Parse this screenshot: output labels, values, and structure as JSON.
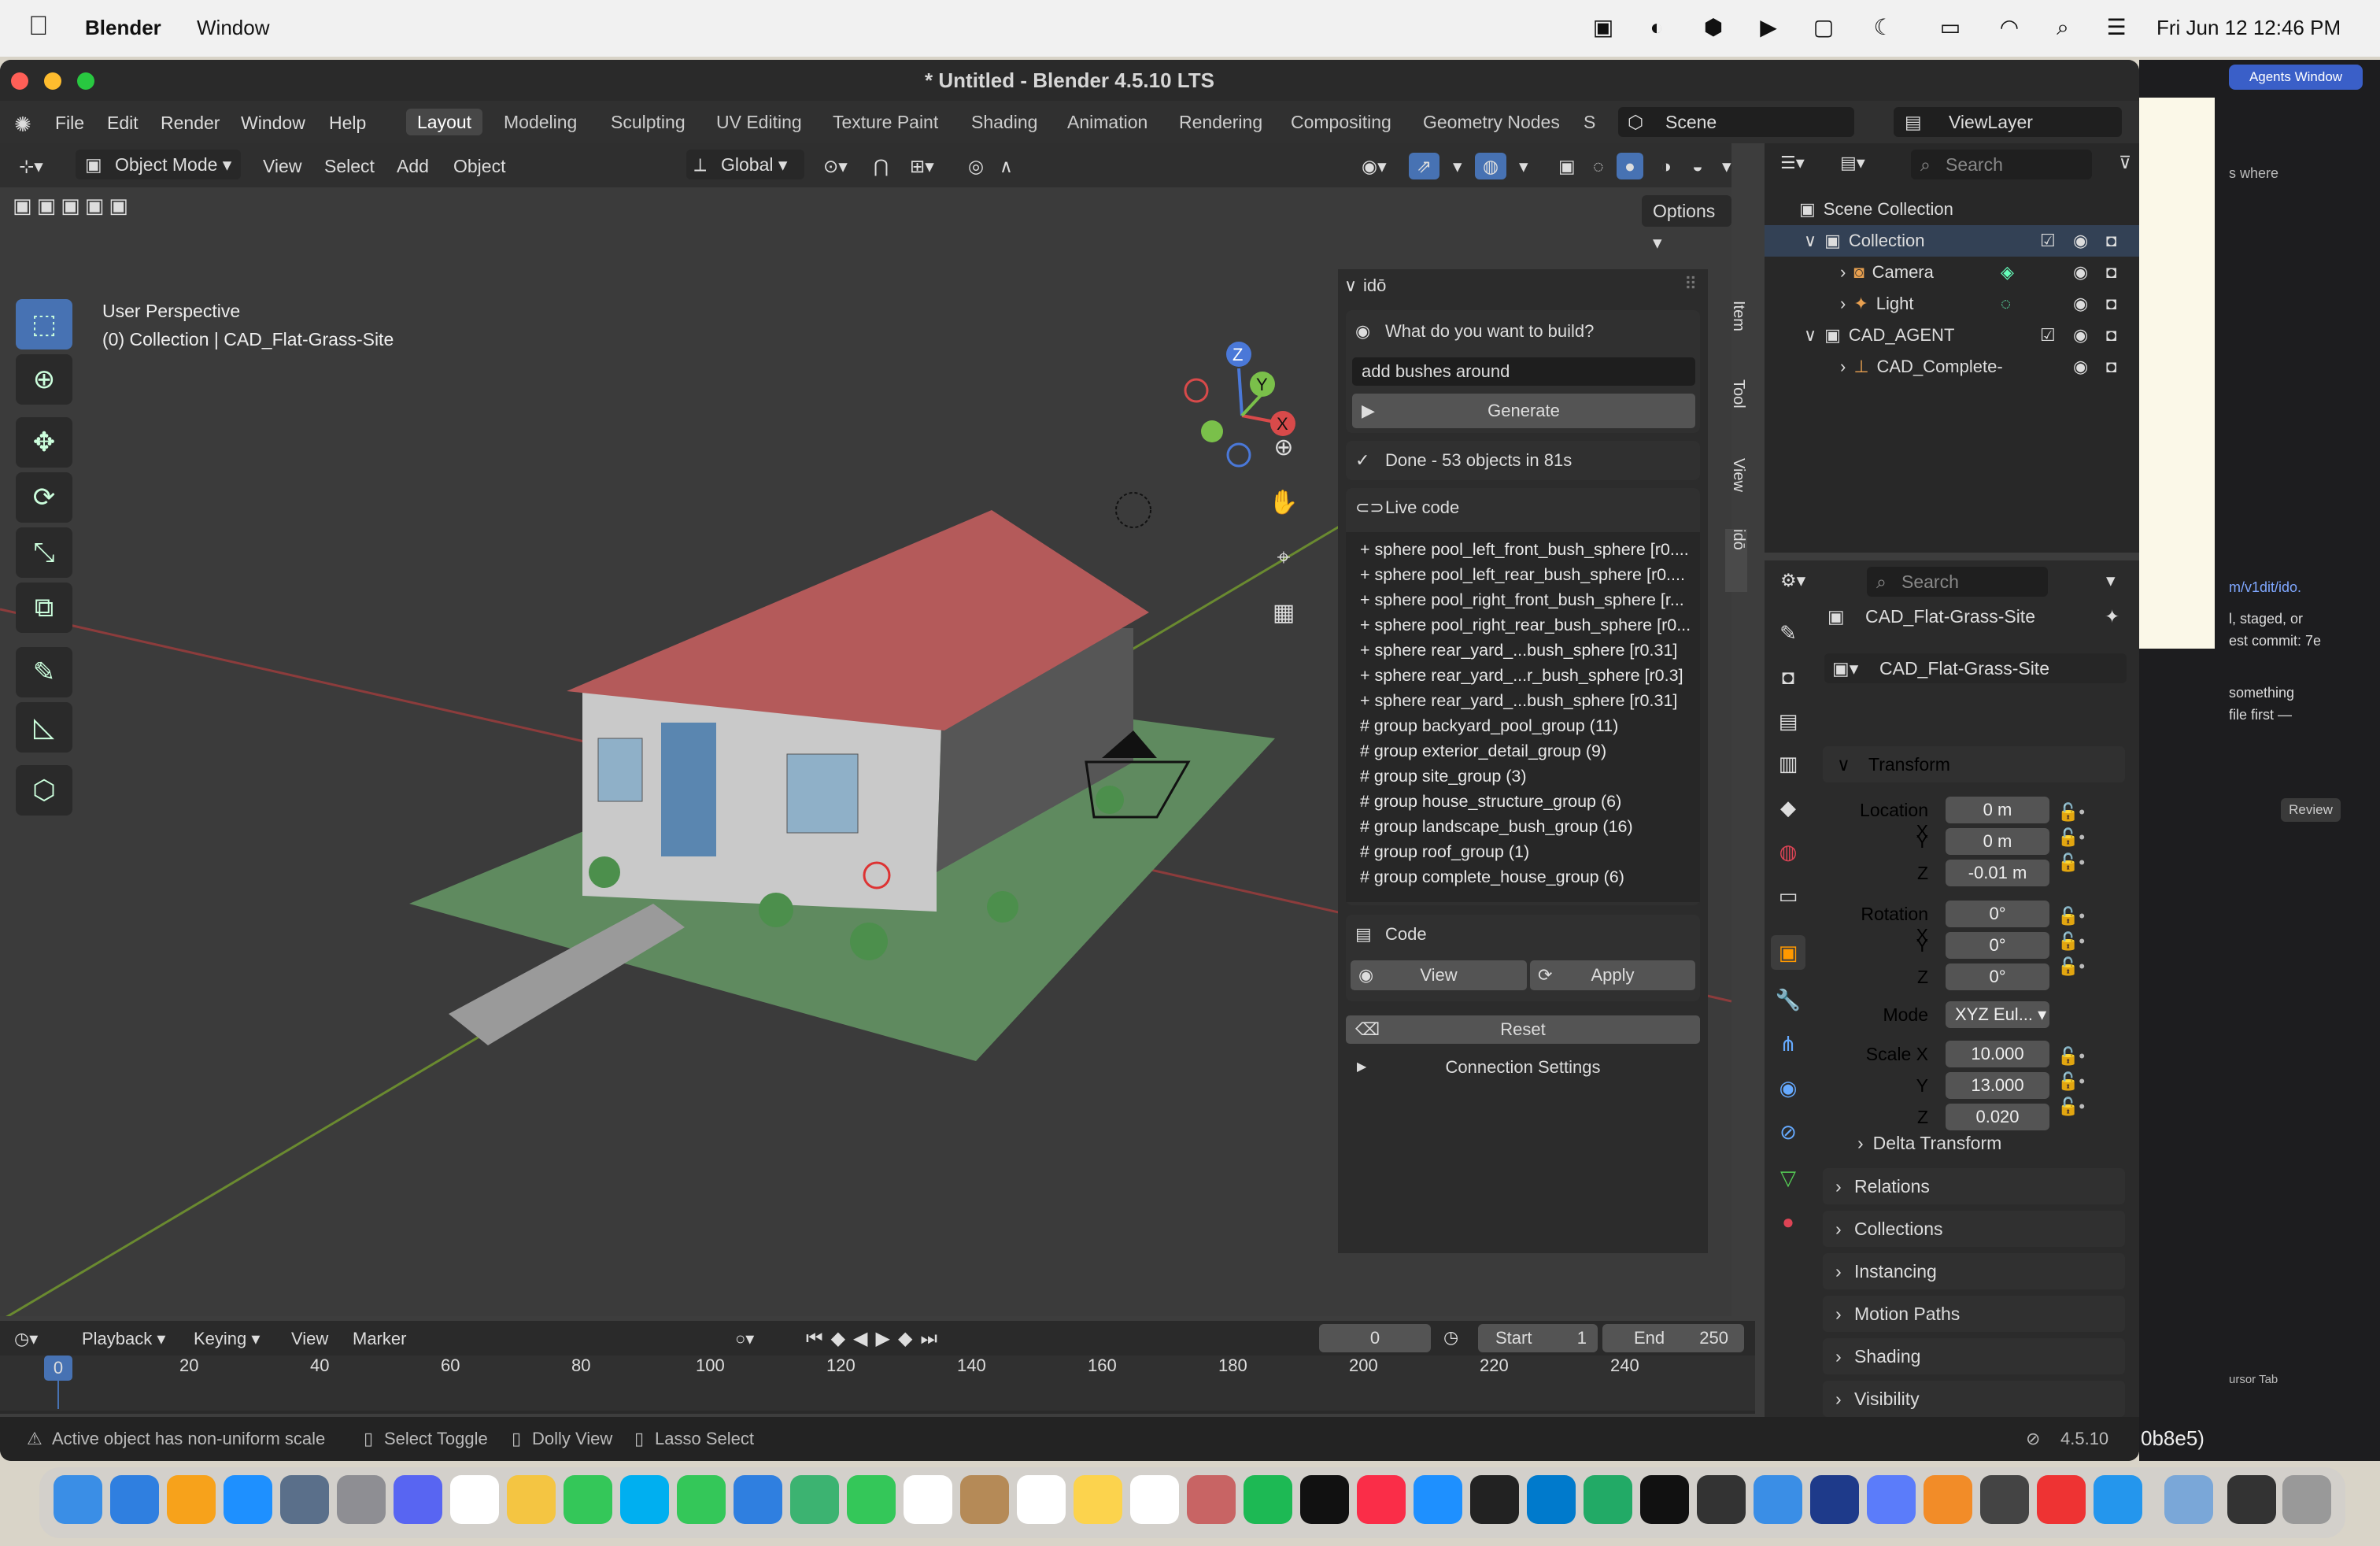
{
  "menubar": {
    "apple": "",
    "app": "Blender",
    "window": "Window",
    "clock": "Fri Jun 12  12:46 PM"
  },
  "window": {
    "title": "* Untitled - Blender 4.5.10 LTS"
  },
  "topmenu": [
    "File",
    "Edit",
    "Render",
    "Window",
    "Help"
  ],
  "workspaces": [
    "Layout",
    "Modeling",
    "Sculpting",
    "UV Editing",
    "Texture Paint",
    "Shading",
    "Animation",
    "Rendering",
    "Compositing",
    "Geometry Nodes",
    "S"
  ],
  "scene": {
    "name": "Scene",
    "view_layer": "ViewLayer"
  },
  "viewport": {
    "mode": "Object Mode",
    "view": "View",
    "select": "Select",
    "add": "Add",
    "object": "Object",
    "transform_orientation": "Global",
    "options": "Options",
    "overlay_title": "User Perspective",
    "overlay_sub": "(0) Collection | CAD_Flat-Grass-Site",
    "gizmo_axes": [
      "Z",
      "Y",
      "X"
    ]
  },
  "ido": {
    "title": "idō",
    "prompt_label": "What do you want to build?",
    "prompt_value": "add bushes around",
    "generate": "Generate",
    "status": "Done - 53 objects in 81s",
    "live_code": "Live code",
    "code_lines": [
      "+ sphere pool_left_front_bush_sphere [r0....",
      "+ sphere pool_left_rear_bush_sphere [r0....",
      "+ sphere pool_right_front_bush_sphere [r...",
      "+ sphere pool_right_rear_bush_sphere [r0...",
      "+ sphere rear_yard_...bush_sphere [r0.31]",
      "+ sphere rear_yard_...r_bush_sphere [r0.3]",
      "+ sphere rear_yard_...bush_sphere [r0.31]",
      "# group backyard_pool_group (11)",
      "# group exterior_detail_group (9)",
      "# group site_group (3)",
      "# group house_structure_group (6)",
      "# group landscape_bush_group (16)",
      "# group roof_group (1)",
      "# group complete_house_group (6)"
    ],
    "code": "Code",
    "view": "View",
    "apply": "Apply",
    "reset": "Reset",
    "connection": "Connection Settings"
  },
  "side_tabs": [
    "Item",
    "Tool",
    "View",
    "idō"
  ],
  "outliner": {
    "search": "Search",
    "rows": [
      {
        "label": "Scene Collection"
      },
      {
        "label": "Collection"
      },
      {
        "label": "Camera"
      },
      {
        "label": "Light"
      },
      {
        "label": "CAD_AGENT"
      },
      {
        "label": "CAD_Complete-"
      }
    ]
  },
  "properties": {
    "search": "Search",
    "object_name": "CAD_Flat-Grass-Site",
    "data_name": "CAD_Flat-Grass-Site",
    "transform": "Transform",
    "location_label": "Location X",
    "y": "Y",
    "z": "Z",
    "loc": [
      "0 m",
      "0 m",
      "-0.01 m"
    ],
    "rotation_label": "Rotation X",
    "rot": [
      "0°",
      "0°",
      "0°"
    ],
    "mode_label": "Mode",
    "mode_value": "XYZ Eul...",
    "scale_label": "Scale X",
    "scale": [
      "10.000",
      "13.000",
      "0.020"
    ],
    "delta": "Delta Transform",
    "sections": [
      "Relations",
      "Collections",
      "Instancing",
      "Motion Paths",
      "Shading",
      "Visibility"
    ]
  },
  "timeline": {
    "playback": "Playback",
    "keying": "Keying",
    "view": "View",
    "marker": "Marker",
    "current": "0",
    "start_label": "Start",
    "start": "1",
    "end_label": "End",
    "end": "250",
    "ticks": [
      "0",
      "20",
      "40",
      "60",
      "80",
      "100",
      "120",
      "140",
      "160",
      "180",
      "200",
      "220",
      "240"
    ]
  },
  "status": {
    "msg": "Active object has non-uniform scale",
    "select": "Select Toggle",
    "dolly": "Dolly View",
    "lasso": "Lasso Select",
    "version": "4.5.10",
    "hash": "0b8e5)"
  },
  "right_window": {
    "agents": "Agents Window",
    "l1": "s where",
    "l2": "m/v1dit/ido.",
    "l3": "l, staged, or",
    "l4": "est commit: 7e",
    "review": "Review",
    "l5": "something",
    "l6": "file first —",
    "l7": "ursor Tab"
  }
}
